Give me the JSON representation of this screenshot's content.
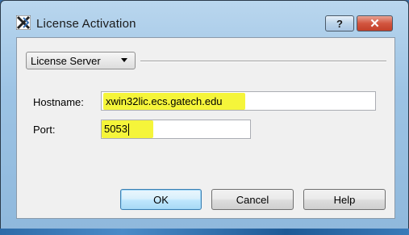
{
  "window": {
    "title": "License Activation",
    "help_caption": "?",
    "close_caption": "✕"
  },
  "server": {
    "mode_selected": "License Server"
  },
  "fields": {
    "hostname_label": "Hostname:",
    "hostname_value": "xwin32lic.ecs.gatech.edu",
    "port_label": "Port:",
    "port_value": "5053"
  },
  "buttons": {
    "ok": "OK",
    "cancel": "Cancel",
    "help": "Help"
  },
  "colors": {
    "highlight": "#f5f53a",
    "close_button": "#c3402a",
    "title_bar": "#9cc3e4"
  },
  "icons": {
    "app_icon": "xwin32-app-icon",
    "dropdown_arrow": "chevron-down-icon"
  }
}
